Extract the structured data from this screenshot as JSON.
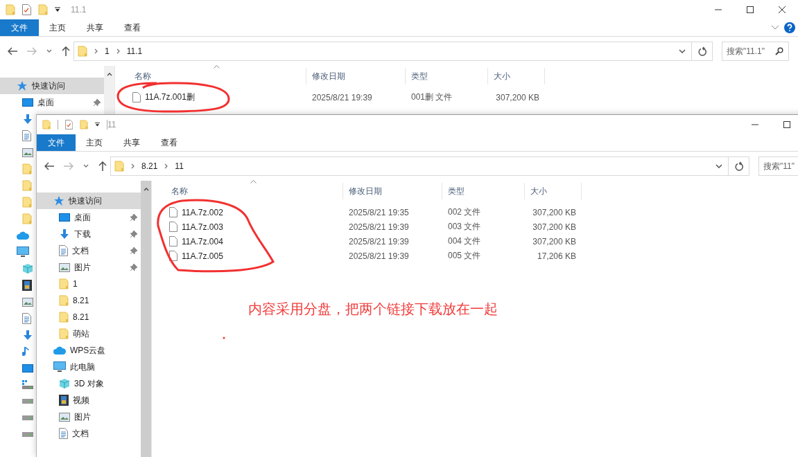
{
  "windows": [
    {
      "title": "11.1",
      "toolbar_separators": false,
      "ribbon_help": true,
      "controls": [
        {
          "kind": "minimize"
        },
        {
          "kind": "maximize"
        },
        {
          "kind": "close"
        }
      ],
      "ribbon_tabs": [
        {
          "label": "文件",
          "kind": "file-menu"
        },
        {
          "label": "主页",
          "kind": "tab"
        },
        {
          "label": "共享",
          "kind": "tab"
        },
        {
          "label": "查看",
          "kind": "tab"
        }
      ],
      "path": [
        "1",
        "11.1"
      ],
      "search": {
        "placeholder": "搜索\"11.1\"",
        "buttons": [
          {
            "kind": "search"
          }
        ]
      },
      "sidebar": [
        {
          "kind": "star",
          "label": "快速访问",
          "selected": true,
          "pinned": false,
          "children": [
            {
              "kind": "desktop",
              "label": "桌面",
              "selected": false,
              "pinned": true
            },
            {
              "kind": "download",
              "selected": false,
              "pinned": false
            },
            {
              "kind": "document",
              "selected": false,
              "pinned": false
            },
            {
              "kind": "picture",
              "selected": false,
              "pinned": false
            },
            {
              "kind": "folder",
              "selected": false,
              "pinned": false
            },
            {
              "kind": "folder",
              "selected": false,
              "pinned": false
            },
            {
              "kind": "folder",
              "selected": false,
              "pinned": false
            },
            {
              "kind": "folder",
              "selected": false,
              "pinned": false
            }
          ]
        },
        {
          "kind": "cloud",
          "selected": false,
          "pinned": false
        },
        {
          "kind": "pc",
          "selected": false,
          "pinned": false,
          "children": [
            {
              "kind": "cube",
              "selected": false,
              "pinned": false
            },
            {
              "kind": "video",
              "selected": false,
              "pinned": false
            },
            {
              "kind": "picture",
              "selected": false,
              "pinned": false
            },
            {
              "kind": "document",
              "selected": false,
              "pinned": false
            },
            {
              "kind": "download",
              "selected": false,
              "pinned": false
            },
            {
              "kind": "music",
              "selected": false,
              "pinned": false
            },
            {
              "kind": "desktop",
              "selected": false,
              "pinned": false
            },
            {
              "kind": "drive-win",
              "selected": false,
              "pinned": false
            },
            {
              "kind": "drive",
              "selected": false,
              "pinned": false
            },
            {
              "kind": "drive",
              "selected": false,
              "pinned": false
            },
            {
              "kind": "drive",
              "selected": false,
              "pinned": false
            }
          ]
        }
      ],
      "columns": [
        "名称",
        "修改日期",
        "类型",
        "大小"
      ],
      "files": [
        {
          "name": "11A.7z.001删",
          "date": "2025/8/21 19:39",
          "type": "001删 文件",
          "size": "307,200 KB"
        }
      ]
    },
    {
      "title": "11",
      "toolbar_separators": true,
      "ribbon_help": false,
      "controls": [
        {
          "kind": "minimize"
        },
        {
          "kind": "maximize"
        }
      ],
      "ribbon_tabs": [
        {
          "label": "文件",
          "kind": "file-menu"
        },
        {
          "label": "主页",
          "kind": "tab"
        },
        {
          "label": "共享",
          "kind": "tab"
        },
        {
          "label": "查看",
          "kind": "tab"
        }
      ],
      "path": [
        "8.21",
        "11"
      ],
      "search": {
        "placeholder": "搜索\"11\""
      },
      "sidebar": [
        {
          "kind": "star",
          "label": "快速访问",
          "selected": true,
          "pinned": false,
          "children": [
            {
              "kind": "desktop",
              "label": "桌面",
              "selected": false,
              "pinned": true
            },
            {
              "kind": "download",
              "label": "下载",
              "selected": false,
              "pinned": true
            },
            {
              "kind": "document",
              "label": "文档",
              "selected": false,
              "pinned": true
            },
            {
              "kind": "picture",
              "label": "图片",
              "selected": false,
              "pinned": true
            },
            {
              "kind": "folder",
              "label": "1",
              "selected": false,
              "pinned": false
            },
            {
              "kind": "folder",
              "label": "8.21",
              "selected": false,
              "pinned": false
            },
            {
              "kind": "folder",
              "label": "8.21",
              "selected": false,
              "pinned": false
            },
            {
              "kind": "folder",
              "label": "萌站",
              "selected": false,
              "pinned": false
            }
          ]
        },
        {
          "kind": "cloud",
          "label": "WPS云盘",
          "selected": false,
          "pinned": false
        },
        {
          "kind": "pc",
          "label": "此电脑",
          "selected": false,
          "pinned": false,
          "children": [
            {
              "kind": "cube",
              "label": "3D 对象",
              "selected": false,
              "pinned": false
            },
            {
              "kind": "video",
              "label": "视频",
              "selected": false,
              "pinned": false
            },
            {
              "kind": "picture",
              "label": "图片",
              "selected": false,
              "pinned": false
            },
            {
              "kind": "document",
              "label": "文档",
              "selected": false,
              "pinned": false
            }
          ]
        }
      ],
      "columns": [
        "名称",
        "修改日期",
        "类型",
        "大小"
      ],
      "files": [
        {
          "name": "11A.7z.002",
          "date": "2025/8/21 19:35",
          "type": "002 文件",
          "size": "307,200 KB"
        },
        {
          "name": "11A.7z.003",
          "date": "2025/8/21 19:39",
          "type": "003 文件",
          "size": "307,200 KB"
        },
        {
          "name": "11A.7z.004",
          "date": "2025/8/21 19:39",
          "type": "004 文件",
          "size": "307,200 KB"
        },
        {
          "name": "11A.7z.005",
          "date": "2025/8/21 19:39",
          "type": "005 文件",
          "size": "17,206 KB"
        }
      ]
    }
  ],
  "annotation": {
    "note": "内容采用分盘，把两个链接下载放在一起"
  }
}
